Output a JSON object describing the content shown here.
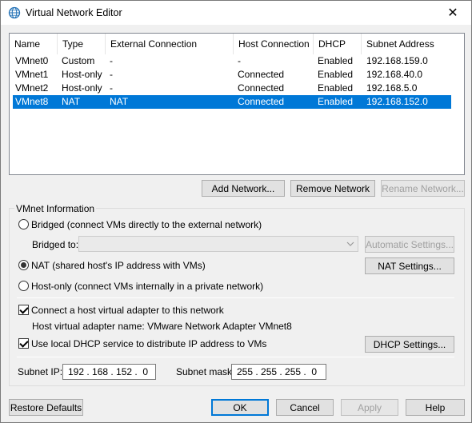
{
  "window": {
    "title": "Virtual Network Editor",
    "close_glyph": "✕"
  },
  "list": {
    "columns": [
      "Name",
      "Type",
      "External Connection",
      "Host Connection",
      "DHCP",
      "Subnet Address"
    ],
    "rows": [
      {
        "name": "VMnet0",
        "type": "Custom",
        "external": "-",
        "host": "-",
        "dhcp": "Enabled",
        "subnet": "192.168.159.0",
        "selected": false
      },
      {
        "name": "VMnet1",
        "type": "Host-only",
        "external": "-",
        "host": "Connected",
        "dhcp": "Enabled",
        "subnet": "192.168.40.0",
        "selected": false
      },
      {
        "name": "VMnet2",
        "type": "Host-only",
        "external": "-",
        "host": "Connected",
        "dhcp": "Enabled",
        "subnet": "192.168.5.0",
        "selected": false
      },
      {
        "name": "VMnet8",
        "type": "NAT",
        "external": "NAT",
        "host": "Connected",
        "dhcp": "Enabled",
        "subnet": "192.168.152.0",
        "selected": true
      }
    ]
  },
  "network_buttons": {
    "add": "Add Network...",
    "remove": "Remove Network",
    "rename": "Rename Network..."
  },
  "vmnet_info": {
    "legend": "VMnet Information",
    "bridged_label": "Bridged (connect VMs directly to the external network)",
    "bridged_to_label": "Bridged to:",
    "bridged_to_value": "",
    "automatic_settings": "Automatic Settings...",
    "nat_label": "NAT (shared host's IP address with VMs)",
    "nat_settings": "NAT Settings...",
    "hostonly_label": "Host-only (connect VMs internally in a private network)",
    "connect_adapter_label": "Connect a host virtual adapter to this network",
    "adapter_name_text": "Host virtual adapter name: VMware Network Adapter VMnet8",
    "dhcp_label": "Use local DHCP service to distribute IP address to VMs",
    "dhcp_settings": "DHCP Settings...",
    "subnet_ip_label": "Subnet IP:",
    "subnet_ip_value": "192 . 168 . 152 .  0",
    "subnet_mask_label": "Subnet mask:",
    "subnet_mask_value": "255 . 255 . 255 .  0",
    "mode": "nat",
    "connect_adapter_checked": true,
    "dhcp_checked": true
  },
  "footer_buttons": {
    "restore": "Restore Defaults",
    "ok": "OK",
    "cancel": "Cancel",
    "apply": "Apply",
    "help": "Help"
  },
  "icons": {
    "app": "network-globe-icon",
    "close": "close-icon",
    "dropdown": "chevron-down-icon"
  },
  "colors": {
    "selection": "#0078d7",
    "default_button_border": "#0078d7"
  }
}
